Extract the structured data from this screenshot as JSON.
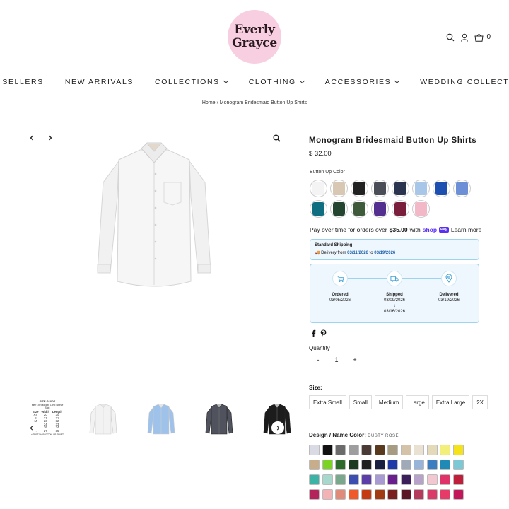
{
  "store": {
    "logo_line1": "Everly",
    "logo_line2": "Grayce",
    "cart_count": "0",
    "icons": [
      "search-icon",
      "account-icon",
      "cart-icon"
    ]
  },
  "nav": [
    {
      "label": "BEST SELLERS",
      "dropdown": false
    },
    {
      "label": "NEW ARRIVALS",
      "dropdown": false
    },
    {
      "label": "COLLECTIONS",
      "dropdown": true
    },
    {
      "label": "CLOTHING",
      "dropdown": true
    },
    {
      "label": "ACCESSORIES",
      "dropdown": true
    },
    {
      "label": "WEDDING COLLECTION",
      "dropdown": true
    }
  ],
  "breadcrumb": "Home › Monogram Bridesmaid Button Up Shirts",
  "product": {
    "title": "Monogram Bridesmaid Button Up Shirts",
    "price": "$ 32.00",
    "option_label": "Button Up Color",
    "color_swatches": [
      "#f4f4f4",
      "#d8c7b2",
      "#222222",
      "#4b4e57",
      "#2b3550",
      "#a8c6e8",
      "#1d4fb0",
      "#6c8fd6",
      "#0f6f80",
      "#24452f",
      "#3f5a3b",
      "#53308f",
      "#7a1f3b",
      "#f3b8c8"
    ]
  },
  "installments": {
    "text_before": "Pay over time for orders over",
    "amount": "$35.00",
    "text_with": "with",
    "shop_pay": "shop",
    "pay_badge": "Pay",
    "learn_more": "Learn more"
  },
  "shipping": {
    "title": "Standard Shipping",
    "prefix": "Delivery from",
    "from": "03/11/2026",
    "to_word": "to",
    "to": "03/19/2026"
  },
  "timeline": {
    "steps": [
      {
        "label": "Ordered",
        "date": "03/05/2026"
      },
      {
        "label": "Shipped",
        "date": "03/09/2026",
        "arrow": "↓",
        "date2": "03/16/2026"
      },
      {
        "label": "Delivered",
        "date": "03/19/2026"
      }
    ]
  },
  "quantity": {
    "label": "Quantity",
    "minus": "-",
    "value": "1",
    "plus": "+"
  },
  "size": {
    "label": "Size:",
    "options": [
      "Extra Small",
      "Small",
      "Medium",
      "Large",
      "Extra Large",
      "2X"
    ]
  },
  "design": {
    "label": "Design / Name Color:",
    "selected": "DUSTY ROSE",
    "colors": [
      "#d9dae3",
      "#111111",
      "#6b6b6b",
      "#9e9e9e",
      "#4a3b36",
      "#5a3a1f",
      "#a79b82",
      "#d4c3a8",
      "#e9e1d2",
      "#e4d9b8",
      "#f2ef7a",
      "#f4e21b",
      "#c7ad8a",
      "#7bd322",
      "#2c6b2a",
      "#1c3a1f",
      "#1f1f1f",
      "#1a2140",
      "#1f3aa8",
      "#9fa9b8",
      "#98b4d8",
      "#3a7ec1",
      "#1f8ab5",
      "#7cc9d6",
      "#3bb4a6",
      "#a7d8cc",
      "#7aa88c",
      "#3c4fb0",
      "#5c3ea8",
      "#a89bd2",
      "#6a1f8f",
      "#3a1f5a",
      "#b7a3c9",
      "#f2c7d2",
      "#e0336a",
      "#c01f3b",
      "#b4245a",
      "#f3b2b6",
      "#e08a7a",
      "#f05a2a",
      "#c63a12",
      "#a13b12",
      "#7a1f1f",
      "#5a1423",
      "#b53a5c",
      "#d93a6a",
      "#e63b68",
      "#c2185b"
    ]
  },
  "gallery": {
    "size_guide": {
      "title": "SIZE GUIDE",
      "sub1": "Men's Broadcloth Long Sleeve",
      "sub2": "Shirt",
      "headers": [
        "Size",
        "Width",
        "Length"
      ],
      "rows": [
        [
          "XS",
          "20",
          "30"
        ],
        [
          "S",
          "21",
          "31"
        ],
        [
          "M",
          "23",
          "32"
        ],
        [
          "L",
          "24",
          "33"
        ],
        [
          "XL",
          "26",
          "34"
        ],
        [
          "2X",
          "27",
          "35"
        ]
      ],
      "foot": "STRETCH BUTTON UP SHIRT"
    },
    "thumb_colors": [
      "#f2f2f2",
      "#9fc2ea",
      "#50535d",
      "#1c1c1c"
    ]
  }
}
